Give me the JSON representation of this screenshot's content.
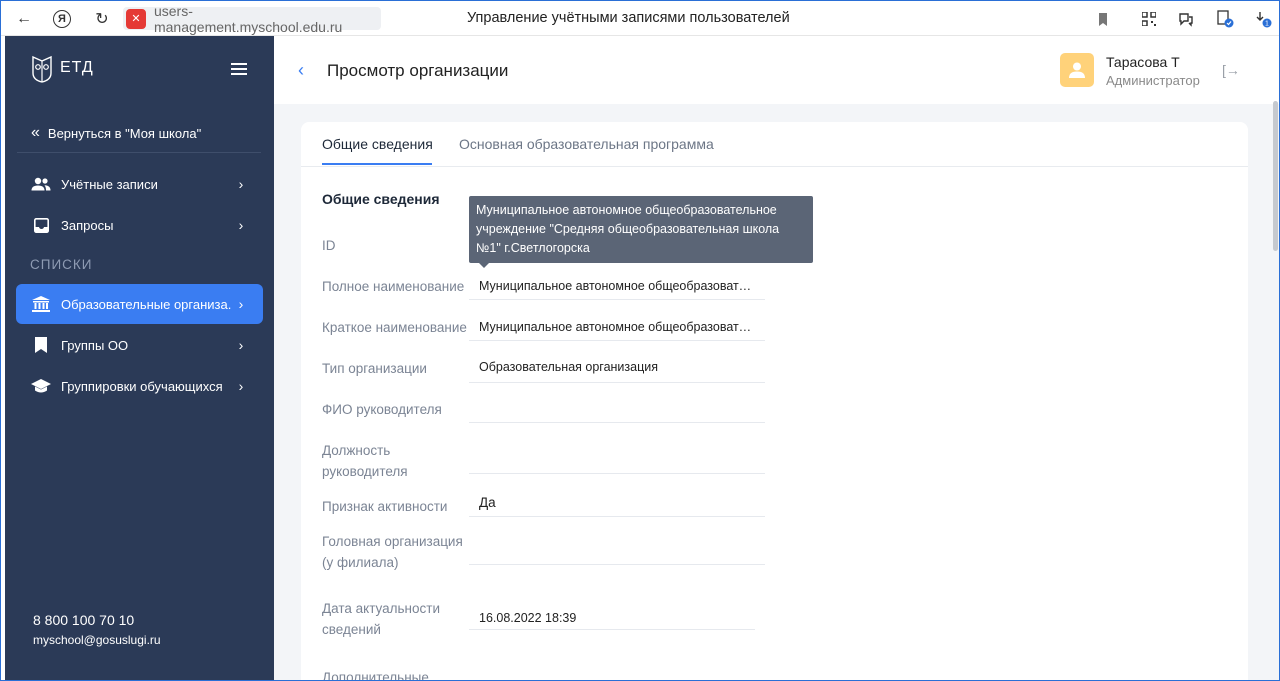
{
  "browser": {
    "url": "users-management.myschool.edu.ru",
    "tab_title": "Управление учётными записями пользователей",
    "back_glyph": "←",
    "yandex_glyph": "Я",
    "reload_glyph": "↻",
    "bookmark_glyph": "🔖",
    "qr_glyph": "▦",
    "extension_glyph": "⧉",
    "profile_glyph": "▣",
    "download_glyph": "⤓",
    "download_badge": "1"
  },
  "sidebar": {
    "logo_text": "ЕТД",
    "back_link": "Вернуться в \"Моя школа\"",
    "items": [
      {
        "label": "Учётные записи",
        "icon": "users-icon"
      },
      {
        "label": "Запросы",
        "icon": "inbox-icon"
      }
    ],
    "section_label": "СПИСКИ",
    "list_items": [
      {
        "label": "Образовательные организа...",
        "icon": "institution-icon",
        "active": true
      },
      {
        "label": "Группы ОО",
        "icon": "bookmark-icon",
        "active": false
      },
      {
        "label": "Группировки обучающихся",
        "icon": "graduation-cap-icon",
        "active": false
      }
    ],
    "phone": "8 800 100 70 10",
    "email": "myschool@gosuslugi.ru",
    "arrow_glyph": "›",
    "back_chevron": "«"
  },
  "header": {
    "title": "Просмотр организации",
    "back_glyph": "‹",
    "user_name": "Тарасова Т",
    "user_role": "Администратор",
    "logout_glyph": "[→"
  },
  "tabs": [
    {
      "label": "Общие сведения",
      "active": true
    },
    {
      "label": "Основная образовательная программа",
      "active": false
    }
  ],
  "section_title": "Общие сведения",
  "fields": [
    {
      "label": "ID",
      "value": ""
    },
    {
      "label": "Полное наименование",
      "value": "Муниципальное автономное общеобразовател..."
    },
    {
      "label": "Краткое наименование",
      "value": "Муниципальное автономное общеобразовател..."
    },
    {
      "label": "Тип организации",
      "value": "Образовательная организация"
    },
    {
      "label": "ФИО руководителя",
      "value": ""
    },
    {
      "label": "Должность руководителя",
      "value": ""
    },
    {
      "label": "Признак активности",
      "value": "Да"
    },
    {
      "label": "Головная организация (у филиала)",
      "value": ""
    },
    {
      "label": "Дата актуальности сведений",
      "value": "16.08.2022 18:39"
    },
    {
      "label": "Дополнительные",
      "value": ""
    }
  ],
  "tooltip": "Муниципальное автономное общеобразовательное учреждение \"Средняя общеобразовательная школа №1\" г.Светлогорска",
  "colors": {
    "sidebar_bg": "#2b3a57",
    "accent": "#3a7df2",
    "avatar_bg": "#ffd27a"
  }
}
